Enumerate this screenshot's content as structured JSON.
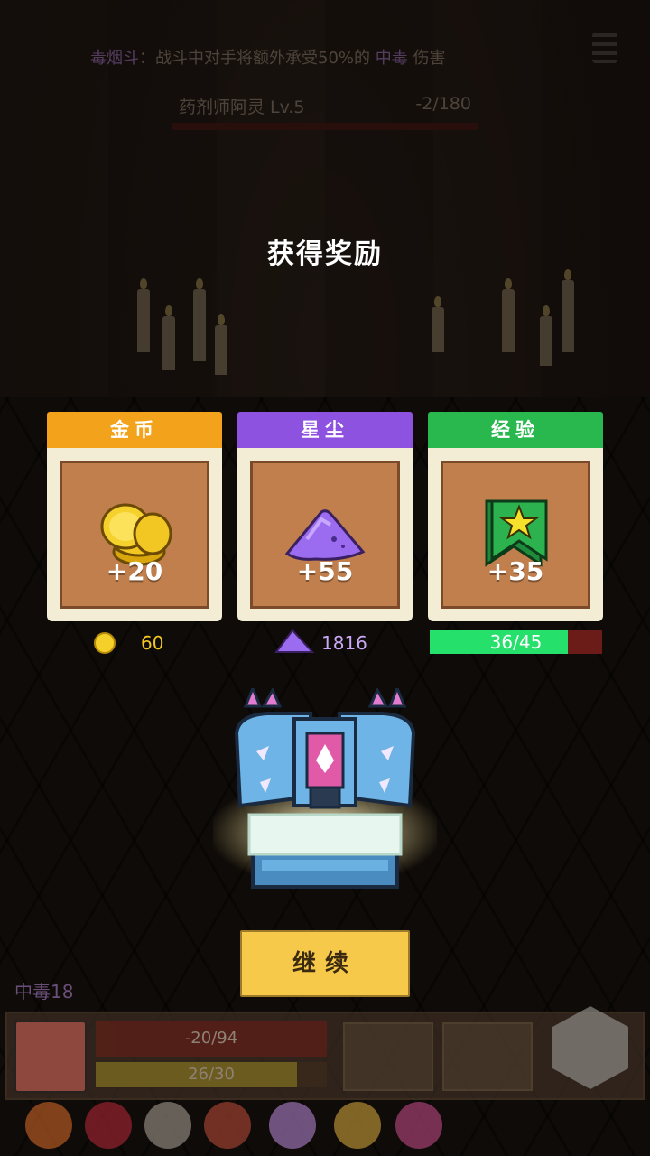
{
  "top": {
    "buff_name": "毒烟斗",
    "buff_text": "：战斗中对手将额外承受50%的",
    "buff_status": "中毒",
    "buff_suffix": " 伤害",
    "enemy_name": "药剂师阿灵  Lv.5",
    "enemy_hp": "-2/180"
  },
  "reward": {
    "title": "获得奖励",
    "cards": [
      {
        "header": "金币",
        "amount": "+20",
        "header_color": "#f2a21b",
        "icon": "gold-coins-icon"
      },
      {
        "header": "星尘",
        "amount": "+55",
        "header_color": "#8e52e0",
        "icon": "stardust-icon"
      },
      {
        "header": "经验",
        "amount": "+35",
        "header_color": "#28b84e",
        "icon": "star-banner-icon"
      }
    ],
    "gold_total": "60",
    "stardust_total": "1816",
    "xp": {
      "label": "36/45",
      "current": 36,
      "max": 45
    }
  },
  "continue_label": "继续",
  "hud": {
    "poison_status": "中毒18",
    "player_hp": "-20/94",
    "player_energy": "26/30"
  }
}
